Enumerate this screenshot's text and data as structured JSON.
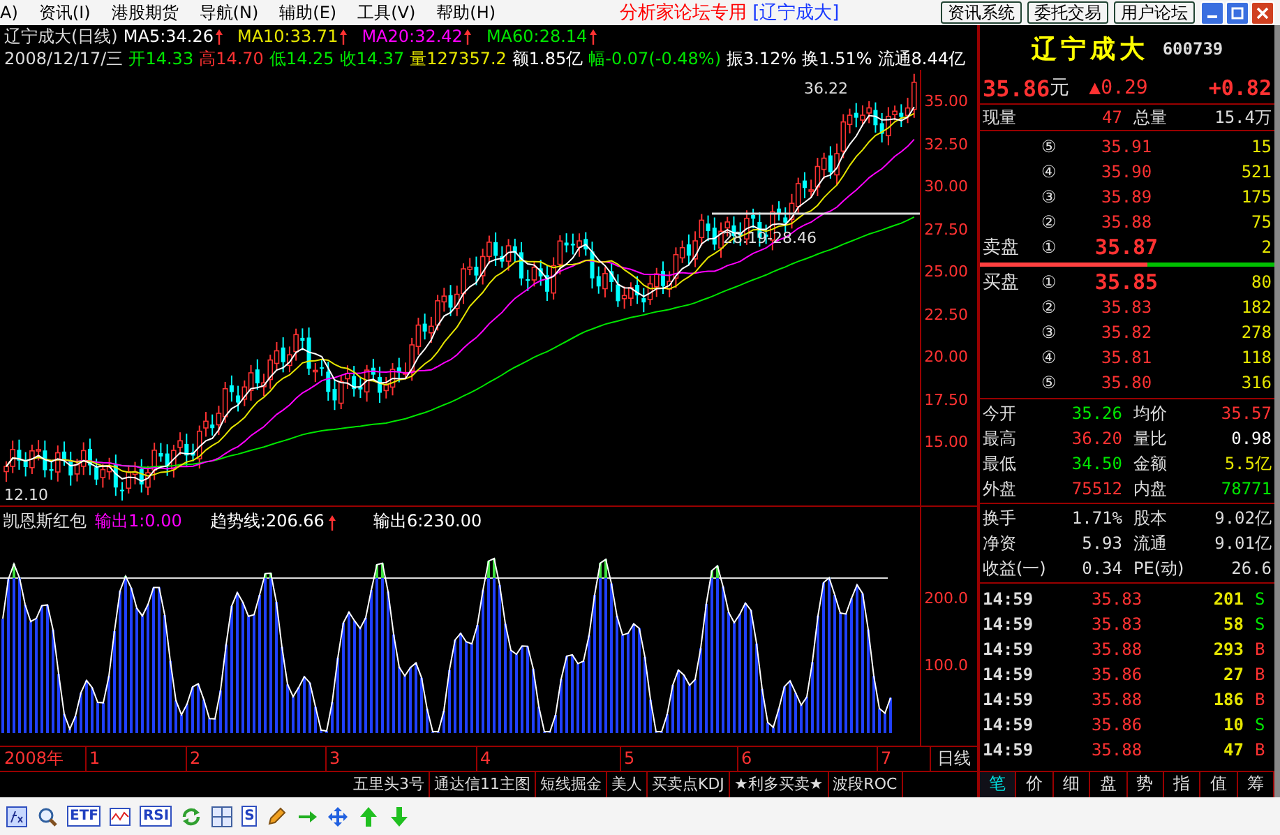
{
  "menu": [
    "A)",
    "资讯(I)",
    "港股期货",
    "导航(N)",
    "辅助(E)",
    "工具(V)",
    "帮助(H)"
  ],
  "title": {
    "brand": "分析家论坛专用",
    "stock": "[辽宁成大]"
  },
  "top_buttons": [
    "资讯系统",
    "委托交易",
    "用户论坛"
  ],
  "chart_header": {
    "name": "辽宁成大(日线)",
    "mas": [
      {
        "label": "MA5:34.26",
        "color": "#ffffff"
      },
      {
        "label": "MA10:33.71",
        "color": "#e6e600"
      },
      {
        "label": "MA20:32.42",
        "color": "#ff00ff"
      },
      {
        "label": "MA60:28.14",
        "color": "#00e600"
      }
    ],
    "date": "2008/12/17/三",
    "fields": [
      {
        "text": "开14.33",
        "color": "#00e600"
      },
      {
        "text": "高14.70",
        "color": "#ff3232"
      },
      {
        "text": "低14.25",
        "color": "#00e600"
      },
      {
        "text": "收14.37",
        "color": "#00e600"
      },
      {
        "text": "量127357.2",
        "color": "#e6e600"
      },
      {
        "text": "额1.85亿",
        "color": "#ffffff"
      },
      {
        "text": "幅-0.07(-0.48%)",
        "color": "#00e600"
      },
      {
        "text": "振3.12%",
        "color": "#ffffff"
      },
      {
        "text": "换1.51%",
        "color": "#ffffff"
      },
      {
        "text": "流通8.44亿",
        "color": "#ffffff"
      }
    ]
  },
  "price_axis": [
    "35.00",
    "32.50",
    "30.00",
    "27.50",
    "25.00",
    "22.50",
    "20.00",
    "17.50",
    "15.00"
  ],
  "annotations": {
    "high": "36.22",
    "range": "28.19-28.46",
    "low": "12.10"
  },
  "indicator": {
    "name": "凯恩斯红包",
    "items": [
      {
        "text": "输出1:0.00",
        "color": "#ff00ff",
        "arrow": false
      },
      {
        "text": "趋势线:206.66",
        "color": "#ffffff",
        "arrow": true
      },
      {
        "text": "输出6:230.00",
        "color": "#ffffff",
        "arrow": false
      }
    ],
    "axis": [
      "200.0",
      "100.0"
    ]
  },
  "date_axis": {
    "year": "2008年",
    "months": [
      "1",
      "2",
      "3",
      "4",
      "5",
      "6",
      "7"
    ],
    "period": "日线"
  },
  "formula_tabs": [
    "五里头3号",
    "通达信11主图",
    "短线掘金",
    "美人",
    "买卖点KDJ",
    "★利多买卖★",
    "波段ROC"
  ],
  "toolbar": [
    {
      "kind": "fx"
    },
    {
      "kind": "zoom"
    },
    {
      "kind": "text",
      "text": "ETF"
    },
    {
      "kind": "wave"
    },
    {
      "kind": "text",
      "text": "RSI"
    },
    {
      "kind": "refresh"
    },
    {
      "kind": "grid"
    },
    {
      "kind": "text",
      "text": "S"
    },
    {
      "kind": "pencil"
    },
    {
      "kind": "right"
    },
    {
      "kind": "move"
    },
    {
      "kind": "up"
    },
    {
      "kind": "down"
    }
  ],
  "quote": {
    "name": "辽宁成大",
    "code": "600739",
    "price": "35.86",
    "unit": "元",
    "change": "▲0.29",
    "change_pct": "+0.82",
    "now_vol_label": "现量",
    "now_vol": "47",
    "total_label": "总量",
    "total": "15.4万",
    "asks": [
      {
        "kind": "level",
        "index": "⑤",
        "price": "35.91",
        "volume": "15"
      },
      {
        "kind": "level",
        "index": "④",
        "price": "35.90",
        "volume": "521"
      },
      {
        "kind": "level",
        "index": "③",
        "price": "35.89",
        "volume": "175"
      },
      {
        "kind": "level",
        "index": "②",
        "price": "35.88",
        "volume": "75"
      },
      {
        "kind": "best",
        "label": "卖盘",
        "index": "①",
        "price": "35.87",
        "volume": "2"
      }
    ],
    "ratio_bar": {
      "level": 0.57
    },
    "bids": [
      {
        "kind": "best",
        "label": "买盘",
        "index": "①",
        "price": "35.85",
        "volume": "80"
      },
      {
        "kind": "level",
        "index": "②",
        "price": "35.83",
        "volume": "182"
      },
      {
        "kind": "level",
        "index": "③",
        "price": "35.82",
        "volume": "278"
      },
      {
        "kind": "level",
        "index": "④",
        "price": "35.81",
        "volume": "118"
      },
      {
        "kind": "level",
        "index": "⑤",
        "price": "35.80",
        "volume": "316"
      }
    ],
    "stats": [
      {
        "label": "今开",
        "value": "35.26",
        "color": "#00e600"
      },
      {
        "label": "均价",
        "value": "35.57",
        "color": "#ff3232"
      },
      {
        "label": "最高",
        "value": "36.20",
        "color": "#ff3232"
      },
      {
        "label": "量比",
        "value": "0.98",
        "color": "#ffffff"
      },
      {
        "label": "最低",
        "value": "34.50",
        "color": "#00e600"
      },
      {
        "label": "金额",
        "value": "5.5亿",
        "color": "#e6e600"
      },
      {
        "label": "外盘",
        "value": "75512",
        "color": "#ff3232"
      },
      {
        "label": "内盘",
        "value": "78771",
        "color": "#00e600"
      }
    ],
    "finance": [
      {
        "l1": "换手",
        "v1": "1.71%",
        "l2": "股本",
        "v2": "9.02亿"
      },
      {
        "l1": "净资",
        "v1": "5.93",
        "l2": "流通",
        "v2": "9.01亿"
      },
      {
        "l1": "收益(一)",
        "v1": "0.34",
        "l2": "PE(动)",
        "v2": "26.6"
      }
    ],
    "ticks": [
      {
        "time": "14:59",
        "price": "35.83",
        "volume": "201",
        "side": "S",
        "color": "#00e600"
      },
      {
        "time": "14:59",
        "price": "35.83",
        "volume": "58",
        "side": "S",
        "color": "#00e600"
      },
      {
        "time": "14:59",
        "price": "35.88",
        "volume": "293",
        "side": "B",
        "color": "#ff3232"
      },
      {
        "time": "14:59",
        "price": "35.86",
        "volume": "27",
        "side": "B",
        "color": "#ff3232"
      },
      {
        "time": "14:59",
        "price": "35.88",
        "volume": "186",
        "side": "B",
        "color": "#ff3232"
      },
      {
        "time": "14:59",
        "price": "35.86",
        "volume": "10",
        "side": "S",
        "color": "#00e600"
      },
      {
        "time": "14:59",
        "price": "35.88",
        "volume": "47",
        "side": "B",
        "color": "#ff3232"
      }
    ],
    "tabs": [
      {
        "label": "笔",
        "selected": true
      },
      {
        "label": "价",
        "selected": false
      },
      {
        "label": "细",
        "selected": false
      },
      {
        "label": "盘",
        "selected": false
      },
      {
        "label": "势",
        "selected": false
      },
      {
        "label": "指",
        "selected": false
      },
      {
        "label": "值",
        "selected": false
      },
      {
        "label": "筹",
        "selected": false
      }
    ]
  }
}
